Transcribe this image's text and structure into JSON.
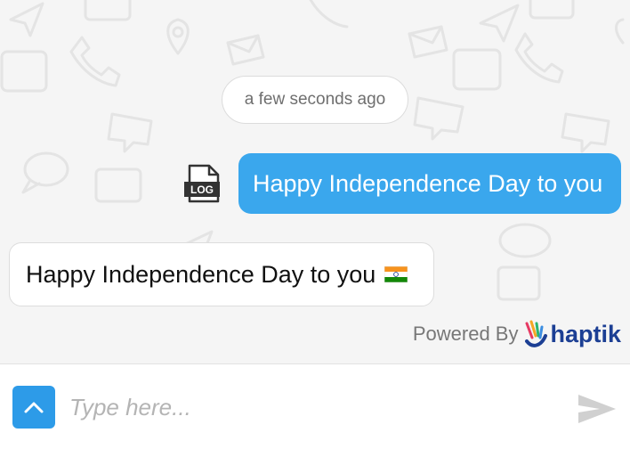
{
  "chat": {
    "timestamp": "a few seconds ago",
    "outgoing_message": "Happy Independence Day to you",
    "incoming_message": "Happy Independence Day to you",
    "log_icon_label": "LOG"
  },
  "footer": {
    "powered_by": "Powered By",
    "brand": "haptik"
  },
  "composer": {
    "placeholder": "Type here...",
    "value": ""
  },
  "colors": {
    "outgoing_bubble": "#3aa7ed",
    "menu_button": "#2d9be8",
    "brand": "#1c3f94",
    "background": "#f5f5f5"
  },
  "icons": {
    "log": "log-file-icon",
    "flag": "india-flag-icon",
    "menu": "chevron-up-icon",
    "send": "send-icon",
    "brand": "haptik-hand-icon"
  }
}
